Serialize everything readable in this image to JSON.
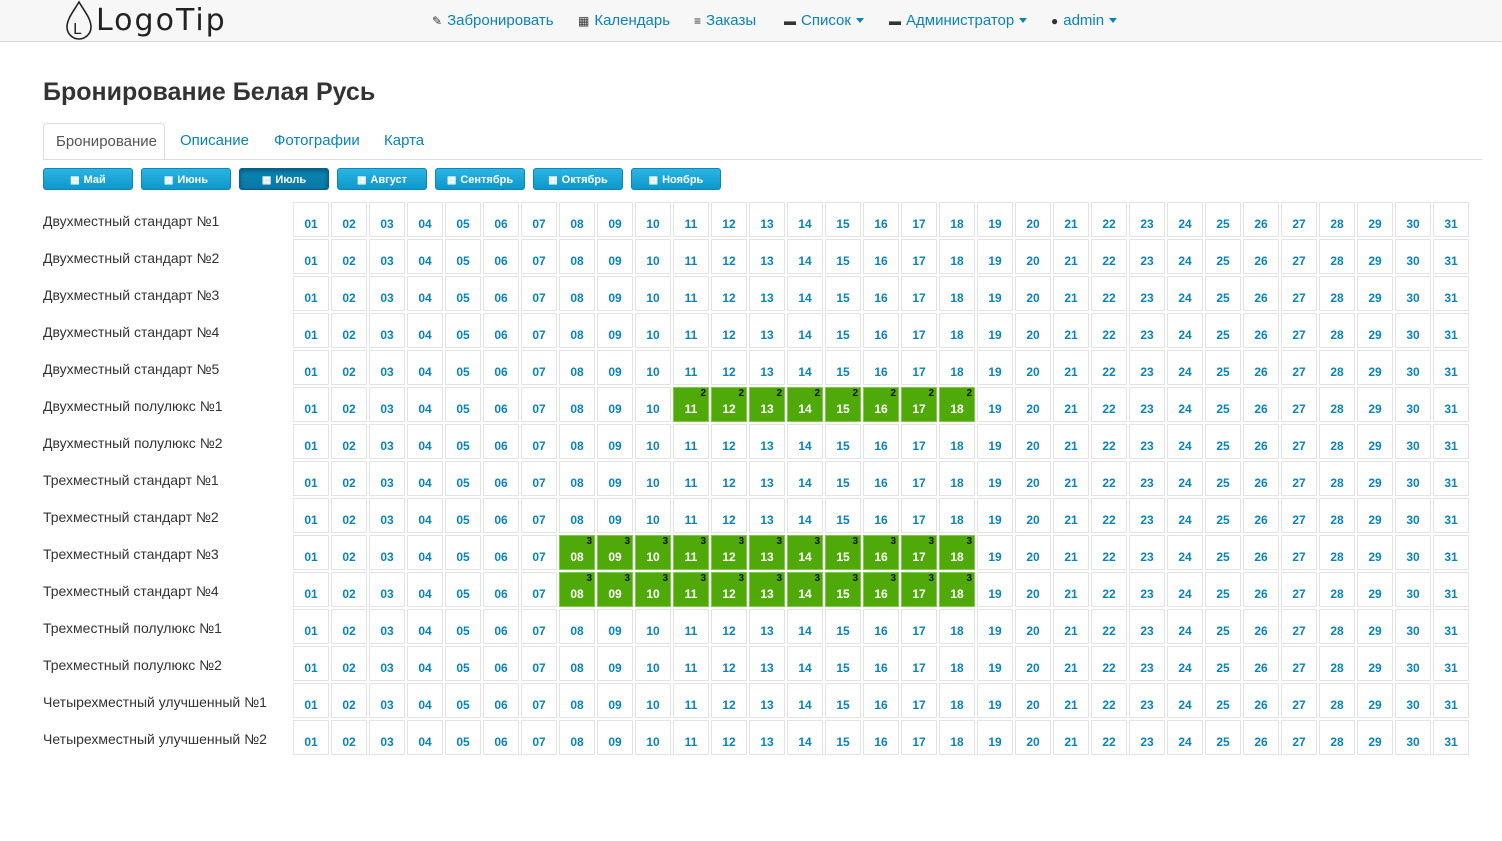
{
  "logo": {
    "text": "LogoTip",
    "mark": "L"
  },
  "nav": {
    "items": [
      {
        "label": "Забронировать",
        "icon": "pencil-icon",
        "glyph": "✎",
        "dropdown": false
      },
      {
        "label": "Календарь",
        "icon": "calendar-icon",
        "glyph": "▦",
        "dropdown": false
      },
      {
        "label": "Заказы",
        "icon": "list-icon",
        "glyph": "≡",
        "dropdown": false
      },
      {
        "label": "Список",
        "icon": "briefcase-icon",
        "glyph": "▬",
        "dropdown": true
      },
      {
        "label": "Администратор",
        "icon": "briefcase-icon",
        "glyph": "▬",
        "dropdown": true
      },
      {
        "label": "admin",
        "icon": "user-icon",
        "glyph": "●",
        "dropdown": true
      }
    ]
  },
  "page": {
    "title": "Бронирование Белая Русь"
  },
  "tabs": [
    {
      "label": "Бронирование",
      "active": true
    },
    {
      "label": "Описание",
      "active": false
    },
    {
      "label": "Фотографии",
      "active": false
    },
    {
      "label": "Карта",
      "active": false
    }
  ],
  "months": [
    {
      "label": "Май",
      "active": false
    },
    {
      "label": "Июнь",
      "active": false
    },
    {
      "label": "Июль",
      "active": true
    },
    {
      "label": "Август",
      "active": false
    },
    {
      "label": "Сентябрь",
      "active": false
    },
    {
      "label": "Октябрь",
      "active": false
    },
    {
      "label": "Ноябрь",
      "active": false
    }
  ],
  "calendar": {
    "days": [
      "01",
      "02",
      "03",
      "04",
      "05",
      "06",
      "07",
      "08",
      "09",
      "10",
      "11",
      "12",
      "13",
      "14",
      "15",
      "16",
      "17",
      "18",
      "19",
      "20",
      "21",
      "22",
      "23",
      "24",
      "25",
      "26",
      "27",
      "28",
      "29",
      "30",
      "31"
    ],
    "colors": {
      "booked": "#4faa09",
      "day_text": "#0a83b9"
    },
    "rooms": [
      {
        "name": "Двухместный стандарт №1",
        "booked": []
      },
      {
        "name": "Двухместный стандарт №2",
        "booked": []
      },
      {
        "name": "Двухместный стандарт №3",
        "booked": []
      },
      {
        "name": "Двухместный стандарт №4",
        "booked": []
      },
      {
        "name": "Двухместный стандарт №5",
        "booked": []
      },
      {
        "name": "Двухместный полулюкс №1",
        "booked": [
          {
            "day": "11",
            "count": "2"
          },
          {
            "day": "12",
            "count": "2"
          },
          {
            "day": "13",
            "count": "2"
          },
          {
            "day": "14",
            "count": "2"
          },
          {
            "day": "15",
            "count": "2"
          },
          {
            "day": "16",
            "count": "2"
          },
          {
            "day": "17",
            "count": "2"
          },
          {
            "day": "18",
            "count": "2"
          }
        ]
      },
      {
        "name": "Двухместный полулюкс №2",
        "booked": []
      },
      {
        "name": "Трехместный стандарт №1",
        "booked": []
      },
      {
        "name": "Трехместный стандарт №2",
        "booked": []
      },
      {
        "name": "Трехместный стандарт №3",
        "booked": [
          {
            "day": "08",
            "count": "3"
          },
          {
            "day": "09",
            "count": "3"
          },
          {
            "day": "10",
            "count": "3"
          },
          {
            "day": "11",
            "count": "3"
          },
          {
            "day": "12",
            "count": "3"
          },
          {
            "day": "13",
            "count": "3"
          },
          {
            "day": "14",
            "count": "3"
          },
          {
            "day": "15",
            "count": "3"
          },
          {
            "day": "16",
            "count": "3"
          },
          {
            "day": "17",
            "count": "3"
          },
          {
            "day": "18",
            "count": "3"
          }
        ]
      },
      {
        "name": "Трехместный стандарт №4",
        "booked": [
          {
            "day": "08",
            "count": "3"
          },
          {
            "day": "09",
            "count": "3"
          },
          {
            "day": "10",
            "count": "3"
          },
          {
            "day": "11",
            "count": "3"
          },
          {
            "day": "12",
            "count": "3"
          },
          {
            "day": "13",
            "count": "3"
          },
          {
            "day": "14",
            "count": "3"
          },
          {
            "day": "15",
            "count": "3"
          },
          {
            "day": "16",
            "count": "3"
          },
          {
            "day": "17",
            "count": "3"
          },
          {
            "day": "18",
            "count": "3"
          }
        ]
      },
      {
        "name": "Трехместный полулюкс №1",
        "booked": []
      },
      {
        "name": "Трехместный полулюкс №2",
        "booked": []
      },
      {
        "name": "Четырехместный улучшенный №1",
        "booked": []
      },
      {
        "name": "Четырехместный улучшенный №2",
        "booked": []
      }
    ]
  }
}
